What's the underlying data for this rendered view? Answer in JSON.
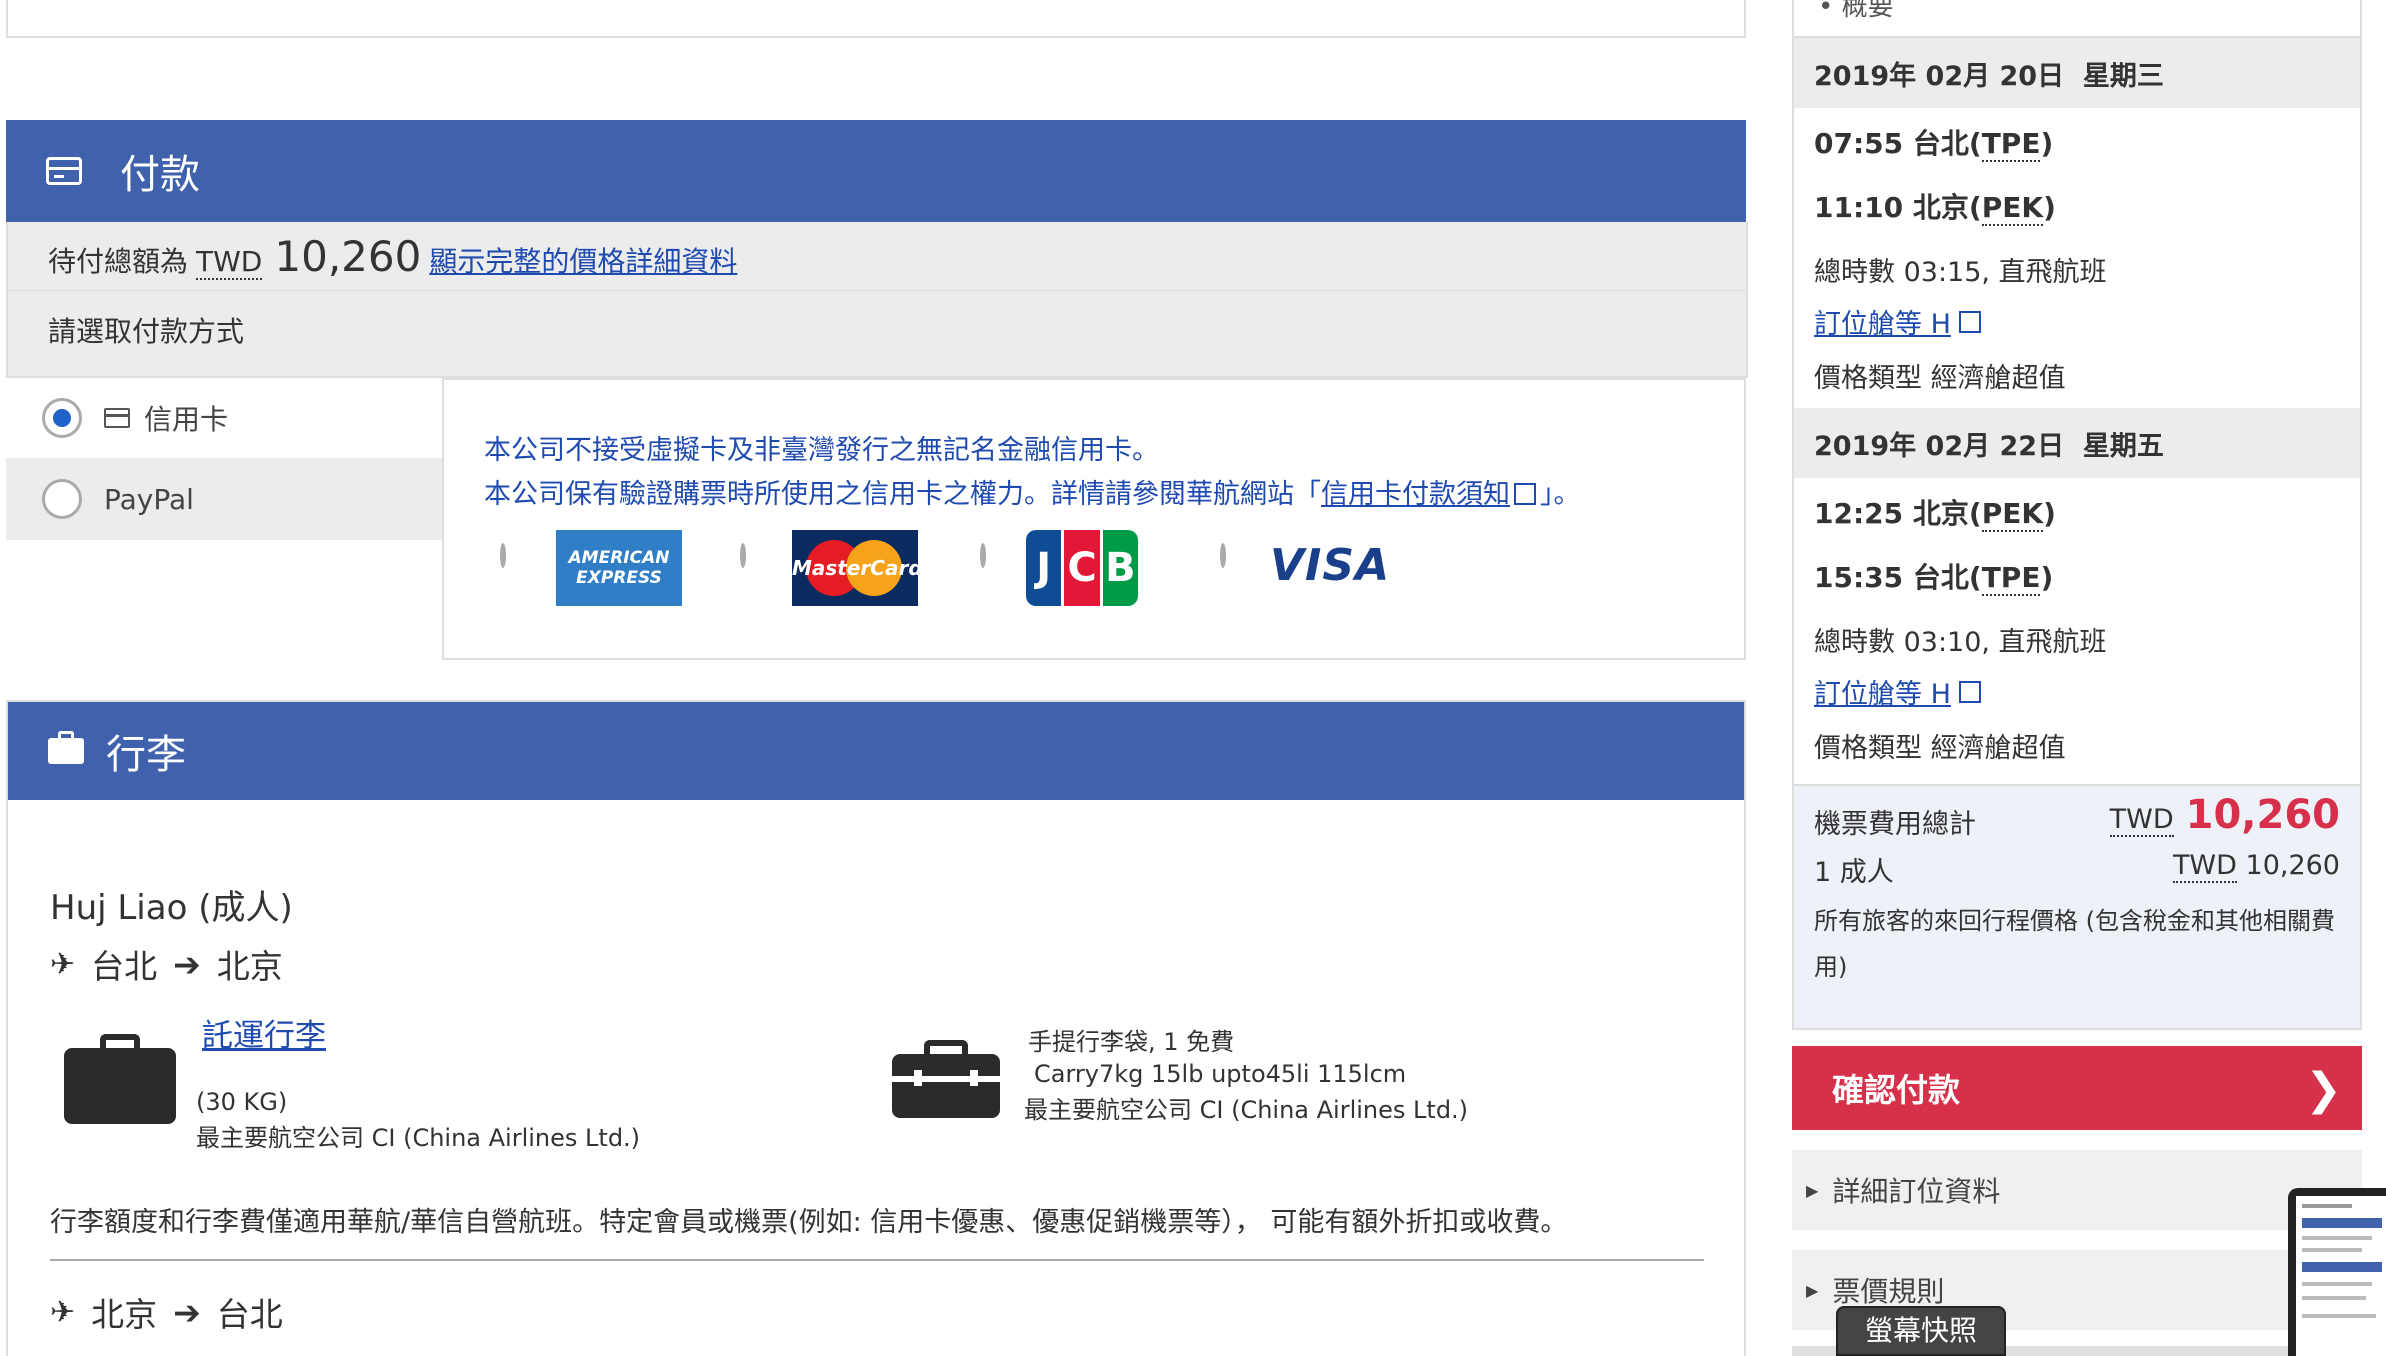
{
  "payment": {
    "section_title": "付款",
    "total_prefix": "待付總額為",
    "currency": "TWD",
    "total_amount": "10,260",
    "details_link": "顯示完整的價格詳細資料",
    "choose_method": "請選取付款方式",
    "methods": [
      {
        "label": "信用卡",
        "selected": true
      },
      {
        "label": "PayPal",
        "selected": false
      }
    ],
    "notice_line1": "本公司不接受虛擬卡及非臺灣發行之無記名金融信用卡。",
    "notice_line2_prefix": "本公司保有驗證購票時所使用之信用卡之權力。詳情請參閱華航網站「",
    "notice_link": "信用卡付款須知",
    "notice_line2_suffix": "」。",
    "cards": [
      {
        "name": "AMERICAN EXPRESS",
        "line1": "AMERICAN",
        "line2": "EXPRESS"
      },
      {
        "name": "MasterCard"
      },
      {
        "name": "JCB"
      },
      {
        "name": "VISA"
      }
    ]
  },
  "baggage": {
    "section_title": "行李",
    "passenger": "Huj Liao (成人)",
    "route1_from": "台北",
    "route1_to": "北京",
    "checked_link": "託運行李",
    "checked_weight": "(30 KG)",
    "checked_carrier": "最主要航空公司 CI (China Airlines Ltd.)",
    "carry_title": "手提行李袋, 1 免費",
    "carry_detail": "Carry7kg 15lb upto45li 115lcm",
    "carry_carrier": "最主要航空公司 CI (China Airlines Ltd.)",
    "note": "行李額度和行李費僅適用華航/華信自營航班。特定會員或機票(例如: 信用卡優惠、優惠促銷機票等）， 可能有額外折扣或收費。",
    "route2_from": "北京",
    "route2_to": "台北"
  },
  "sidebar": {
    "top_cut": "• 概要",
    "flights": [
      {
        "date": "2019年 02月 20日  星期三",
        "dep_time": "07:55",
        "dep_city": "台北",
        "dep_code": "TPE",
        "arr_time": "11:10",
        "arr_city": "北京",
        "arr_code": "PEK",
        "duration": "總時數 03:15, 直飛航班",
        "class_link": "訂位艙等 H",
        "fare_type": "價格類型 經濟艙超值"
      },
      {
        "date": "2019年 02月 22日  星期五",
        "dep_time": "12:25",
        "dep_city": "北京",
        "dep_code": "PEK",
        "arr_time": "15:35",
        "arr_city": "台北",
        "arr_code": "TPE",
        "duration": "總時數 03:10, 直飛航班",
        "class_link": "訂位艙等 H",
        "fare_type": "價格類型 經濟艙超值"
      }
    ],
    "total_label": "機票費用總計",
    "total_currency": "TWD",
    "total_amount": "10,260",
    "pax_label": "1 成人",
    "pax_currency": "TWD",
    "pax_amount": "10,260",
    "total_note": "所有旅客的來回行程價格 (包含稅金和其他相關費用)",
    "confirm_button": "確認付款",
    "booking_details": "詳細訂位資料",
    "fare_rules": "票價規則"
  },
  "screenshot_tooltip": "螢幕快照",
  "colors": {
    "header_blue": "#4062ad",
    "confirm_red": "#d7304a",
    "link_blue": "#1f4bb0",
    "price_red": "#d7304a"
  }
}
